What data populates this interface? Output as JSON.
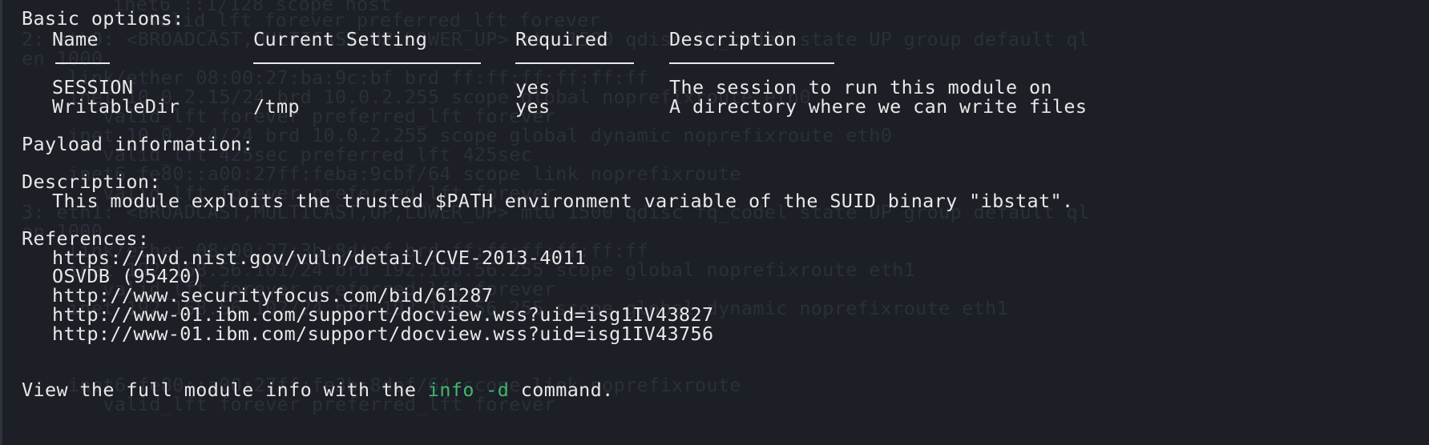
{
  "terminal": {
    "ghost_lines": [
      "    inet6 ::1/128 scope host",
      "       valid_lft forever preferred_lft forever",
      "2: eth0: <BROADCAST,MULTICAST,UP,LOWER_UP> mtu 1500 qdisc fq_codel state UP group default ql",
      "en 1000",
      "    link/ether 08:00:27:ba:9c:bf brd ff:ff:ff:ff:ff:ff",
      "    inet 10.0.2.15/24 brd 10.0.2.255 scope global noprefixroute eth0",
      "       valid_lft forever preferred_lft forever",
      "    inet 10.0.2.4/24 brd 10.0.2.255 scope global dynamic noprefixroute eth0",
      "       valid_lft 425sec preferred_lft 425sec",
      "    inet6 fe80::a00:27ff:feba:9cbf/64 scope link noprefixroute",
      "       valid_lft forever preferred_lft forever",
      "3: eth1: <BROADCAST,MULTICAST,UP,LOWER_UP> mtu 1500 qdisc fq_codel state UP group default ql",
      "en 1000",
      "    link/ether 08:00:27:3b:8d:ef brd ff:ff:ff:ff:ff:ff",
      "    inet 192.168.56.101/24 brd 192.168.56.255 scope global noprefixroute eth1",
      "       valid_lft forever preferred_lft forever",
      "    inet 192.168.56.102/24 brd 192.168.56.255 scope global dynamic noprefixroute eth1",
      "    inet6 fe80::a00:27ff:fe3b:8def/64 scope link noprefixroute",
      "       valid_lft forever preferred_lft forever"
    ],
    "basic_options_heading": "Basic options:",
    "table": {
      "headers": {
        "name": "Name",
        "current_setting": "Current Setting",
        "required": "Required",
        "description": "Description"
      },
      "rows": [
        {
          "name": "SESSION",
          "current_setting": "",
          "required": "yes",
          "description": "The session to run this module on"
        },
        {
          "name": "WritableDir",
          "current_setting": "/tmp",
          "required": "yes",
          "description": "A directory where we can write files"
        }
      ]
    },
    "payload_heading": "Payload information:",
    "description_heading": "Description:",
    "description_text": "This module exploits the trusted $PATH environment variable of the SUID binary \"ibstat\".",
    "references_heading": "References:",
    "references": [
      "https://nvd.nist.gov/vuln/detail/CVE-2013-4011",
      "OSVDB (95420)",
      "http://www.securityfocus.com/bid/61287",
      "http://www-01.ibm.com/support/docview.wss?uid=isg1IV43827",
      "http://www-01.ibm.com/support/docview.wss?uid=isg1IV43756"
    ],
    "footer": {
      "prefix": "View the full module info with the ",
      "command": "info -d",
      "suffix": " command."
    },
    "colors": {
      "background": "#1c1f26",
      "foreground": "#e8e8e8",
      "ghost_text": "#2b2f38",
      "command_accent": "#3fb86b"
    }
  }
}
